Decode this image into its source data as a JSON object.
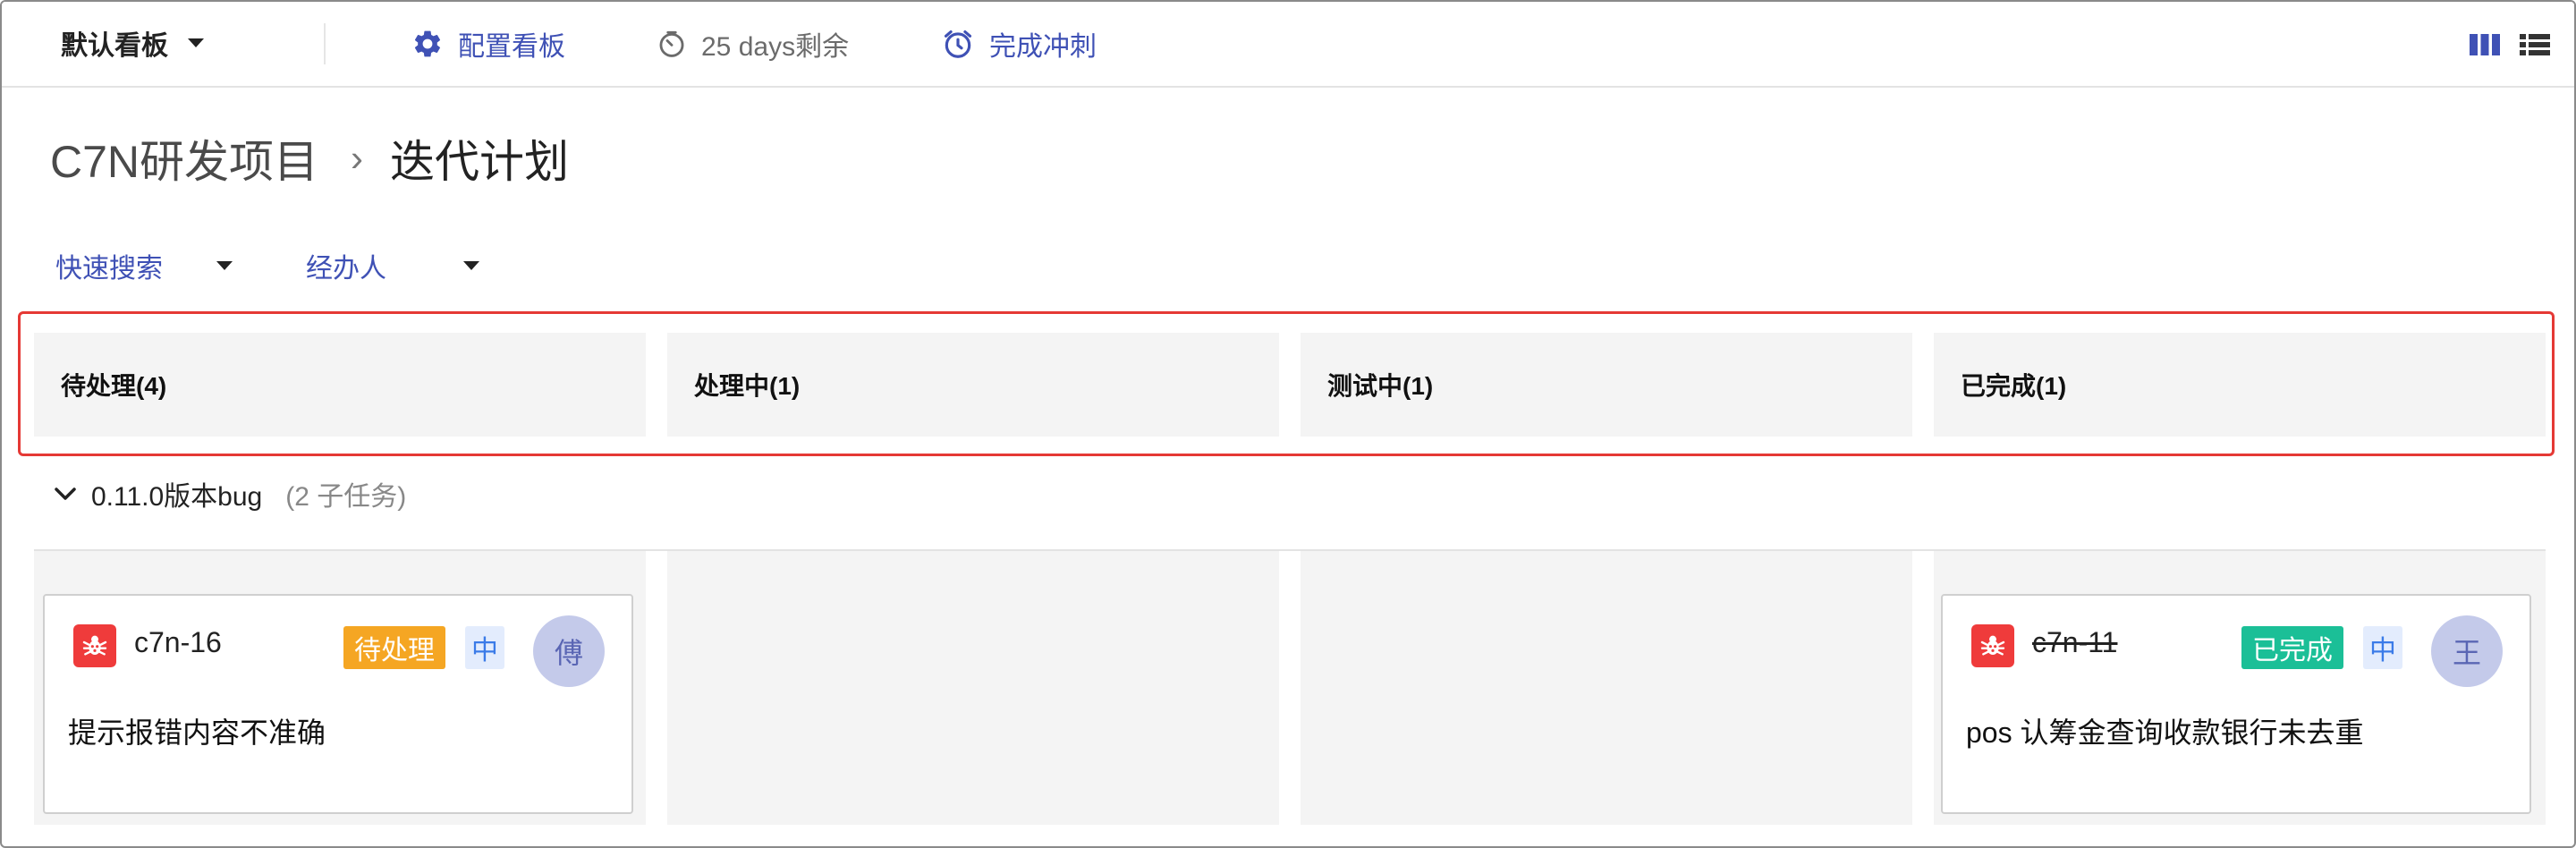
{
  "topbar": {
    "board_name": "默认看板",
    "config_label": "配置看板",
    "days_left": "25 days剩余",
    "complete_sprint": "完成冲刺"
  },
  "breadcrumb": {
    "project": "C7N研发项目",
    "separator": "›",
    "page": "迭代计划"
  },
  "filters": {
    "quick_search": "快速搜索",
    "assignee": "经办人"
  },
  "columns": [
    {
      "label": "待处理(4)"
    },
    {
      "label": "处理中(1)"
    },
    {
      "label": "测试中(1)"
    },
    {
      "label": "已完成(1)"
    }
  ],
  "swimlane": {
    "title": "0.11.0版本bug",
    "subtasks": "(2 子任务)"
  },
  "cards": [
    {
      "id": "c7n-16",
      "status": "待处理",
      "status_color": "#f5a623",
      "priority": "中",
      "avatar": "傅",
      "summary": "提示报错内容不准确",
      "icon": "bug-icon"
    },
    {
      "id": "c7n-11",
      "status": "已完成",
      "status_color": "#1bbf97",
      "priority": "中",
      "avatar": "王",
      "summary": "pos 认筹金查询收款银行未去重",
      "icon": "bug-icon"
    }
  ],
  "colors": {
    "accent": "#3f51b5",
    "highlight_border": "#e53935",
    "bug": "#ef3b3b"
  }
}
